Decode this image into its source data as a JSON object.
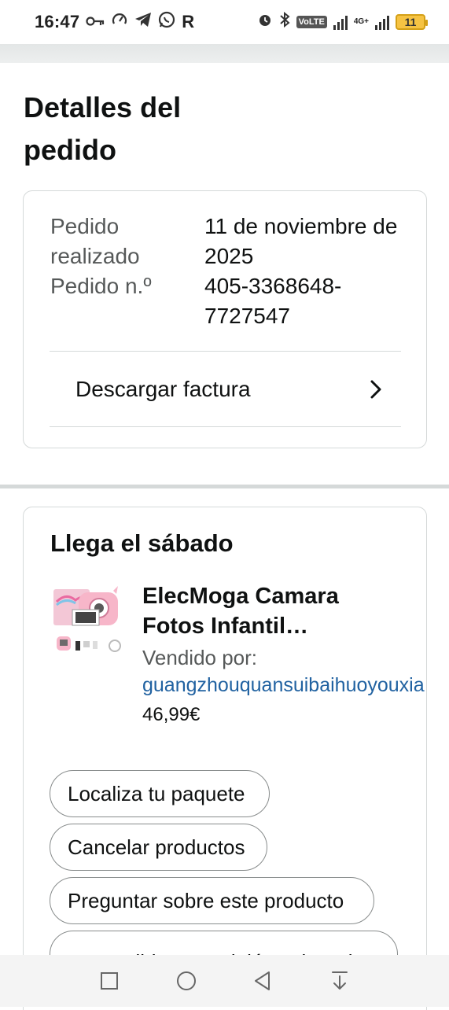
{
  "status_bar": {
    "time": "16:47",
    "left_icons": [
      "key-icon",
      "speed-icon",
      "telegram-icon",
      "whatsapp-icon",
      "r-icon"
    ],
    "r_letter": "R",
    "volte": "VoLTE",
    "network": "4G+",
    "battery_level": "11"
  },
  "page": {
    "title": "Detalles del pedido"
  },
  "order": {
    "placed_label": "Pedido realizado",
    "placed_value": "11 de noviembre de 2025",
    "number_label": "Pedido n.º",
    "number_value": "405-3368648-7727547",
    "invoice_label": "Descargar factura"
  },
  "delivery": {
    "title": "Llega el sábado",
    "product_name": "ElecMoga Camara Fotos Infantil Instantanea",
    "sold_by_label": "Vendido por:",
    "seller": "guangzhouquansuibaihuoyouxia",
    "price": "46,99€",
    "actions": [
      "Localiza tu paquete",
      "Cancelar productos",
      "Preguntar sobre este producto",
      "Escribir una opinión sobre el"
    ]
  },
  "colors": {
    "link": "#2162a1",
    "border": "#d5d9d9",
    "text_secondary": "#565959",
    "battery": "#f6c343"
  }
}
